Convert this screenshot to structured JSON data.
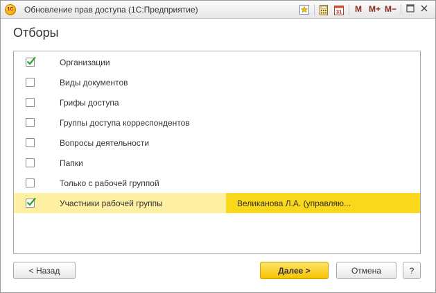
{
  "window": {
    "title": "Обновление прав доступа  (1С:Предприятие)",
    "logo_text": "1С"
  },
  "toolbar": {
    "icons": [
      "favorite-star-icon",
      "calculator-icon",
      "calendar-icon"
    ],
    "calendar_day": "31",
    "mem_m": "M",
    "mem_mplus": "M+",
    "mem_mminus": "M−"
  },
  "heading": "Отборы",
  "filters": [
    {
      "label": "Организации",
      "checked": true
    },
    {
      "label": "Виды документов",
      "checked": false
    },
    {
      "label": "Грифы доступа",
      "checked": false
    },
    {
      "label": "Группы доступа корреспондентов",
      "checked": false
    },
    {
      "label": "Вопросы деятельности",
      "checked": false
    },
    {
      "label": "Папки",
      "checked": false
    },
    {
      "label": "Только с рабочей группой",
      "checked": false
    },
    {
      "label": "Участники рабочей группы",
      "checked": true,
      "value": "Великанова Л.А. (управляю..."
    }
  ],
  "buttons": {
    "back": "< Назад",
    "next": "Далее >",
    "cancel": "Отмена",
    "help": "?"
  },
  "colors": {
    "check": "#2aa02a",
    "selected_row": "#fdf0a3",
    "selected_value": "#f9d71a",
    "primary_button": "#f5c400"
  }
}
